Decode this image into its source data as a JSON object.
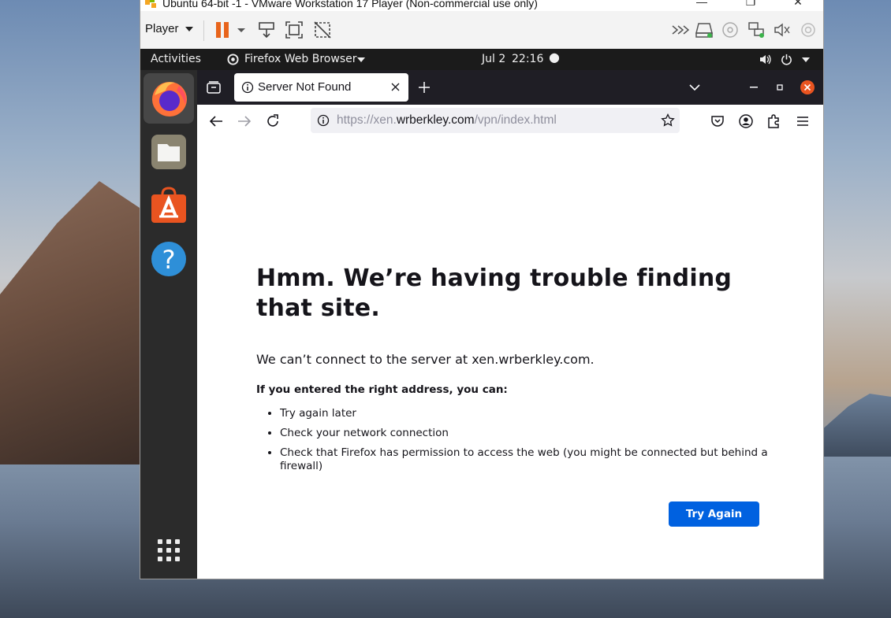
{
  "vmware": {
    "title": "Ubuntu 64-bit -1 - VMware Workstation 17 Player (Non-commercial use only)",
    "player_menu": "Player",
    "window_controls": [
      "—",
      "❐",
      "✕"
    ],
    "icons": [
      "pause-icon",
      "send-keys-icon",
      "fullscreen-icon",
      "unity-icon",
      "forward-icon",
      "hdd-icon",
      "cd-icon",
      "network-icon",
      "audio-icon",
      "usb-icon"
    ]
  },
  "ubuntu": {
    "activities": "Activities",
    "app_menu": "Firefox Web Browser",
    "date": "Jul 2",
    "time": "22:16",
    "dock": [
      "firefox-icon",
      "files-icon",
      "app-center-icon",
      "help-icon",
      "show-apps-icon"
    ]
  },
  "firefox": {
    "tab": {
      "label": "Server Not Found"
    },
    "url": {
      "prefix": "https://xen.",
      "domain": "wrberkley.com",
      "path": "/vpn/index.html"
    },
    "page": {
      "title": "Hmm. We’re having trouble finding that site.",
      "description": "We can’t connect to the server at xen.wrberkley.com.",
      "subtitle": "If you entered the right address, you can:",
      "suggestions": [
        "Try again later",
        "Check your network connection",
        "Check that Firefox has permission to access the web (you might be connected but behind a firewall)"
      ],
      "try_again": "Try Again"
    }
  },
  "colors": {
    "accent": "#0061e0",
    "ubuntu_orange": "#e95420",
    "ff_dark": "#1f1e25"
  }
}
